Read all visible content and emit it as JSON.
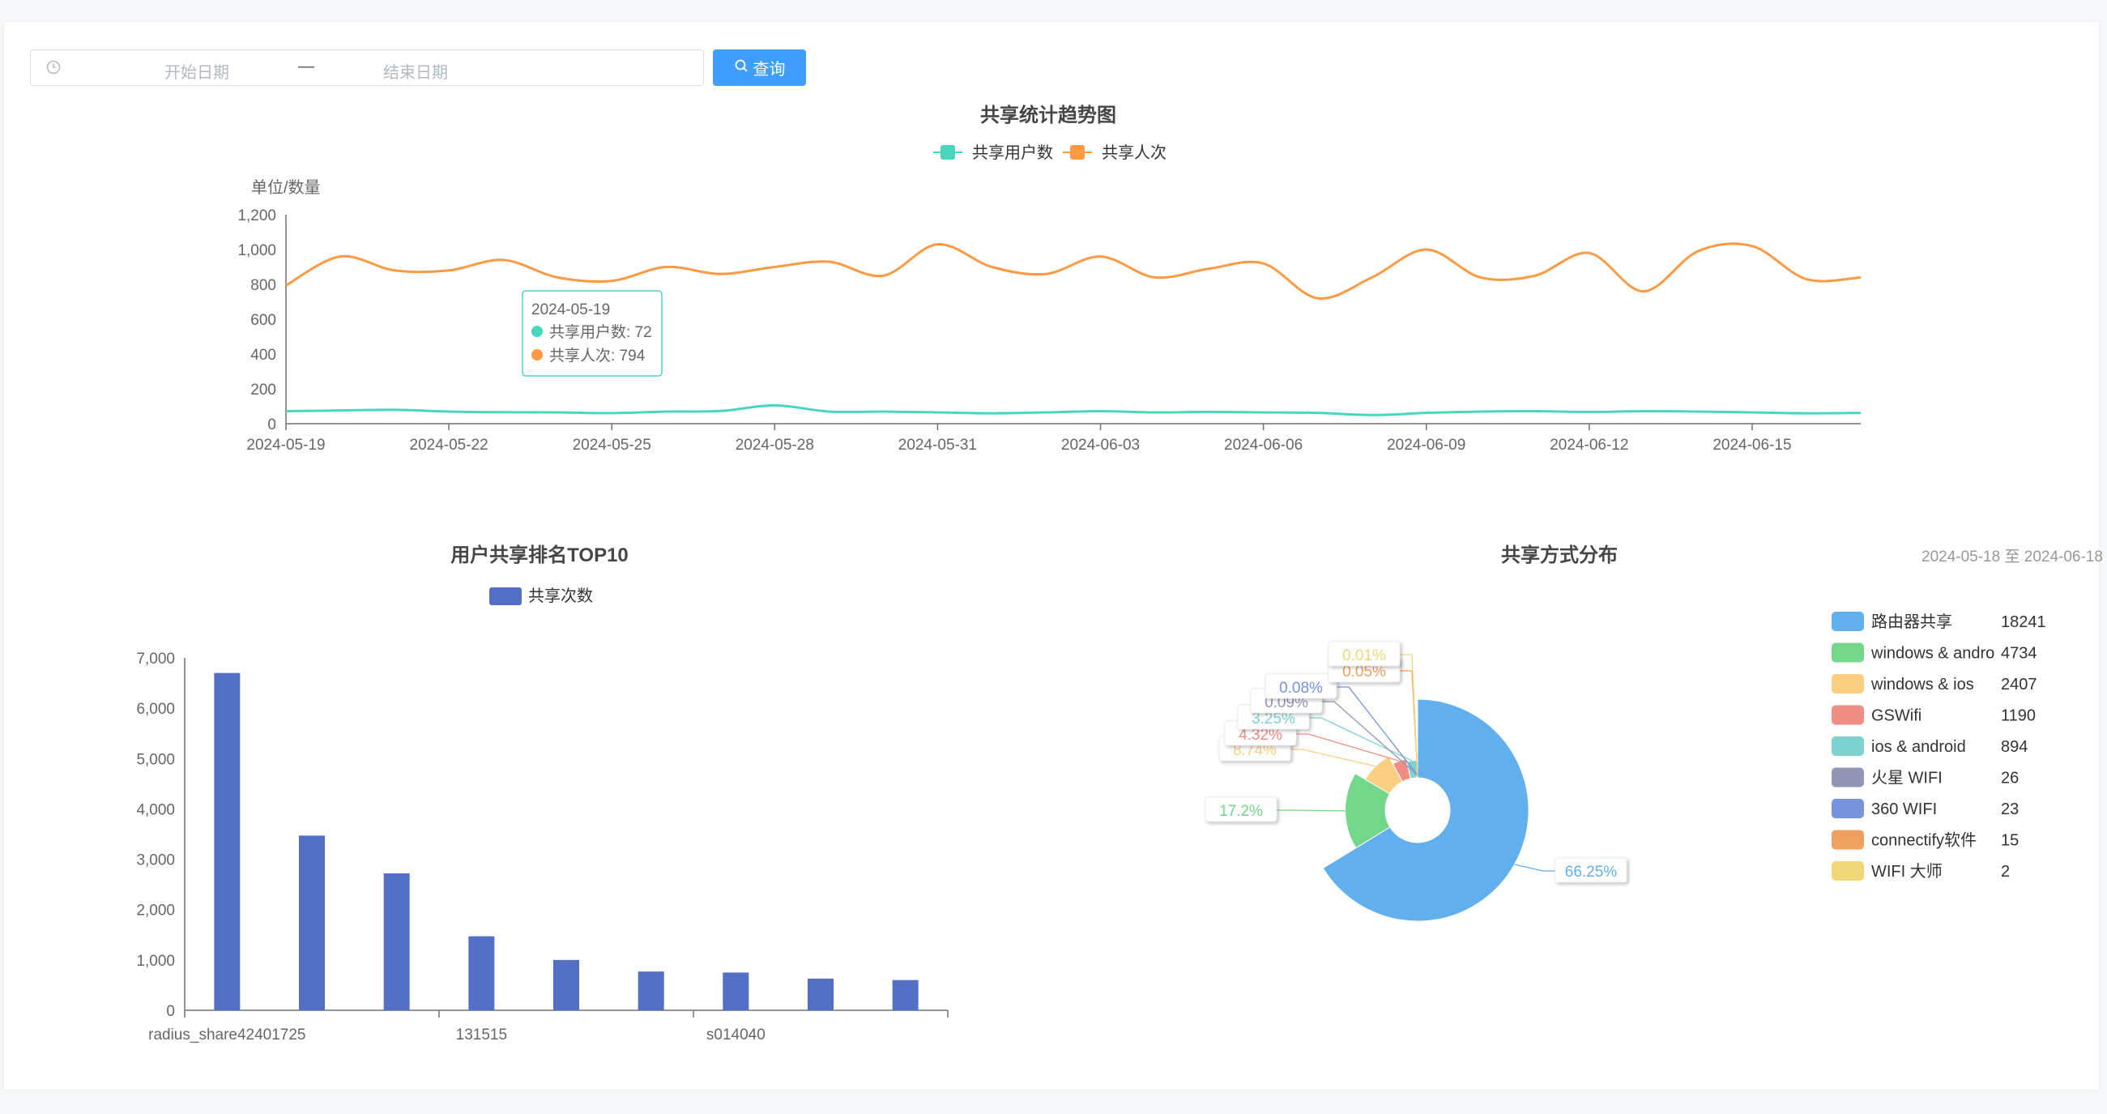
{
  "filter": {
    "start_placeholder": "开始日期",
    "separator": "—",
    "end_placeholder": "结束日期",
    "query_label": "查询",
    "icons": {
      "clock": "clock-icon",
      "search": "search-icon"
    },
    "query_color": "#409eff"
  },
  "chart_data": [
    {
      "type": "line",
      "title": "共享统计趋势图",
      "ylabel": "单位/数量",
      "ylim": [
        0,
        1200
      ],
      "yticks": [
        "0",
        "200",
        "400",
        "600",
        "800",
        "1,000",
        "1,200"
      ],
      "x": [
        "2024-05-19",
        "2024-05-20",
        "2024-05-21",
        "2024-05-22",
        "2024-05-23",
        "2024-05-24",
        "2024-05-25",
        "2024-05-26",
        "2024-05-27",
        "2024-05-28",
        "2024-05-29",
        "2024-05-30",
        "2024-05-31",
        "2024-06-01",
        "2024-06-02",
        "2024-06-03",
        "2024-06-04",
        "2024-06-05",
        "2024-06-06",
        "2024-06-07",
        "2024-06-08",
        "2024-06-09",
        "2024-06-10",
        "2024-06-11",
        "2024-06-12",
        "2024-06-13",
        "2024-06-14",
        "2024-06-15",
        "2024-06-16",
        "2024-06-17"
      ],
      "xtick_labels": [
        "2024-05-19",
        "2024-05-22",
        "2024-05-25",
        "2024-05-28",
        "2024-05-31",
        "2024-06-03",
        "2024-06-06",
        "2024-06-09",
        "2024-06-12",
        "2024-06-15"
      ],
      "legend_position": "top-center",
      "grid": false,
      "series": [
        {
          "name": "共享用户数",
          "color": "#4ad6bd",
          "values": [
            72,
            76,
            80,
            70,
            66,
            65,
            61,
            70,
            73,
            105,
            70,
            70,
            65,
            60,
            65,
            72,
            65,
            68,
            65,
            62,
            50,
            62,
            70,
            72,
            68,
            72,
            70,
            65,
            60,
            62
          ]
        },
        {
          "name": "共享人次",
          "color": "#fd9a43",
          "values": [
            794,
            960,
            880,
            880,
            940,
            840,
            820,
            900,
            860,
            900,
            930,
            850,
            1030,
            900,
            860,
            960,
            840,
            890,
            920,
            720,
            840,
            1000,
            840,
            850,
            980,
            760,
            990,
            1020,
            830,
            840
          ]
        }
      ],
      "tooltip": {
        "date": "2024-05-19",
        "rows": [
          "共享用户数: 72",
          "共享人次: 794"
        ]
      }
    },
    {
      "type": "bar",
      "title": "用户共享排名TOP10",
      "legend": "共享次数",
      "color": "#5470c6",
      "ylim": [
        0,
        7000
      ],
      "yticks": [
        "0",
        "1,000",
        "2,000",
        "3,000",
        "4,000",
        "5,000",
        "6,000",
        "7,000"
      ],
      "categories": [
        "radius_share42401725",
        "",
        "",
        "131515",
        "",
        "",
        "s014040",
        "",
        ""
      ],
      "values": [
        6700,
        3470,
        2720,
        1470,
        1000,
        770,
        750,
        630,
        600
      ]
    },
    {
      "type": "pie",
      "title": "共享方式分布",
      "date_range": "2024-05-18 至 2024-06-18",
      "legend_position": "right",
      "slices": [
        {
          "label": "路由器共享",
          "value": 18241,
          "color": "#61b0ed",
          "pct": "66.25%"
        },
        {
          "label": "windows & andro",
          "value": 4734,
          "color": "#73d68a",
          "pct": "17.2%"
        },
        {
          "label": "windows & ios",
          "value": 2407,
          "color": "#fbcf82",
          "pct": "8.74%"
        },
        {
          "label": "GSWifi",
          "value": 1190,
          "color": "#f08e86",
          "pct": "4.32%"
        },
        {
          "label": "ios & android",
          "value": 894,
          "color": "#7cd3d0",
          "pct": "3.25%"
        },
        {
          "label": "火星 WIFI",
          "value": 26,
          "color": "#9296b4",
          "pct": "0.09%"
        },
        {
          "label": "360 WIFI",
          "value": 23,
          "color": "#7793dd",
          "pct": "0.08%"
        },
        {
          "label": "connectify软件",
          "value": 15,
          "color": "#eda060",
          "pct": "0.05%"
        },
        {
          "label": "WIFI 大师",
          "value": 2,
          "color": "#efd77a",
          "pct": "0.01%"
        }
      ]
    }
  ]
}
